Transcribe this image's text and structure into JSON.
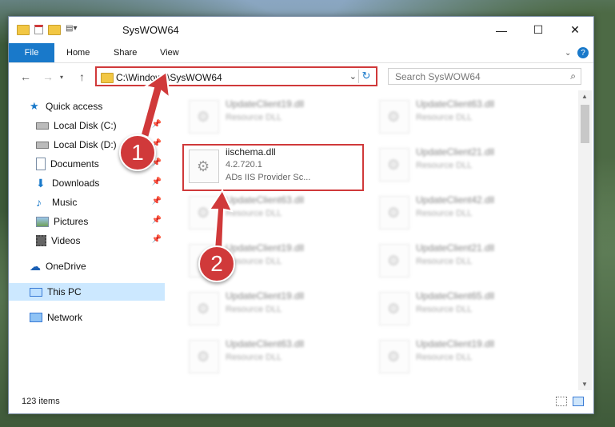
{
  "window": {
    "title": "SysWOW64"
  },
  "ribbon": {
    "file": "File",
    "home": "Home",
    "share": "Share",
    "view": "View",
    "help": "?"
  },
  "address": {
    "path": "C:\\Windows\\SysWOW64"
  },
  "search": {
    "placeholder": "Search SysWOW64"
  },
  "nav": {
    "quick_access": "Quick access",
    "local_c": "Local Disk (C:)",
    "local_d": "Local Disk (D:)",
    "documents": "Documents",
    "downloads": "Downloads",
    "music": "Music",
    "pictures": "Pictures",
    "videos": "Videos",
    "onedrive": "OneDrive",
    "thispc": "This PC",
    "network": "Network"
  },
  "files": {
    "r1c1": {
      "name": "UpdateClient19.dll",
      "type": "Resource DLL"
    },
    "r1c2": {
      "name": "UpdateClient63.dll",
      "type": "Resource DLL"
    },
    "main": {
      "name": "iischema.dll",
      "version": "4.2.720.1",
      "desc": "ADs IIS Provider Sc..."
    },
    "r2c2": {
      "name": "UpdateClient21.dll",
      "type": "Resource DLL"
    },
    "r3c1": {
      "name": "UpdateClient63.dll",
      "type": "Resource DLL"
    },
    "r3c2": {
      "name": "UpdateClient42.dll",
      "type": "Resource DLL"
    },
    "r4c1": {
      "name": "UpdateClient19.dll",
      "type": "Resource DLL"
    },
    "r4c2": {
      "name": "UpdateClient21.dll",
      "type": "Resource DLL"
    },
    "r5c1": {
      "name": "UpdateClient19.dll",
      "type": "Resource DLL"
    },
    "r5c2": {
      "name": "UpdateClient65.dll",
      "type": "Resource DLL"
    },
    "r6c1": {
      "name": "UpdateClient63.dll",
      "type": "Resource DLL"
    },
    "r6c2": {
      "name": "UpdateClient19.dll",
      "type": "Resource DLL"
    }
  },
  "status": {
    "items": "123 items"
  },
  "annotations": {
    "step1": "1",
    "step2": "2",
    "color": "#d0393a"
  }
}
